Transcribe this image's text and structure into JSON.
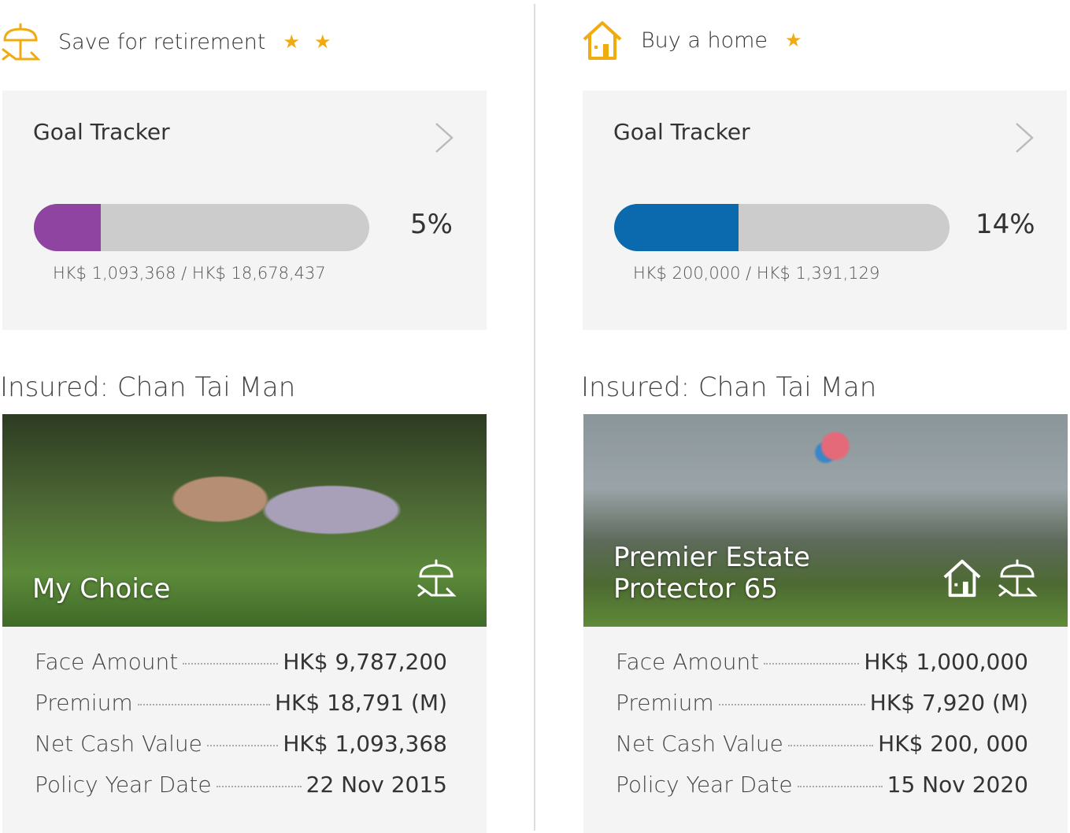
{
  "goals": [
    {
      "title": "Save for retirement",
      "stars": 2,
      "icon": "beach-umbrella-icon",
      "tracker_title": "Goal Tracker",
      "progress_pct": 5,
      "progress_label": "5%",
      "amounts": "HK$ 1,093,368 / HK$ 18,678,437",
      "bar_color": "#8e44a0",
      "insured": "Insured: Chan Tai Man",
      "plan": "My Choice",
      "rows": [
        {
          "label": "Face Amount",
          "value": "HK$ 9,787,200"
        },
        {
          "label": "Premium",
          "value": "HK$ 18,791 (M)"
        },
        {
          "label": "Net Cash Value",
          "value": "HK$ 1,093,368"
        },
        {
          "label": "Policy Year Date",
          "value": "22 Nov 2015"
        }
      ]
    },
    {
      "title": "Buy a home",
      "stars": 1,
      "icon": "house-icon",
      "tracker_title": "Goal Tracker",
      "progress_pct": 14,
      "progress_label": "14%",
      "amounts": "HK$ 200,000 / HK$ 1,391,129",
      "bar_color": "#0a6aad",
      "insured": "Insured: Chan Tai Man",
      "plan": "Premier Estate Protector 65",
      "rows": [
        {
          "label": "Face Amount",
          "value": "HK$ 1,000,000"
        },
        {
          "label": "Premium",
          "value": "HK$ 7,920 (M)"
        },
        {
          "label": "Net Cash Value",
          "value": "HK$ 200, 000"
        },
        {
          "label": "Policy Year Date",
          "value": "15 Nov 2020"
        }
      ]
    }
  ],
  "accent": "#f0ab10"
}
